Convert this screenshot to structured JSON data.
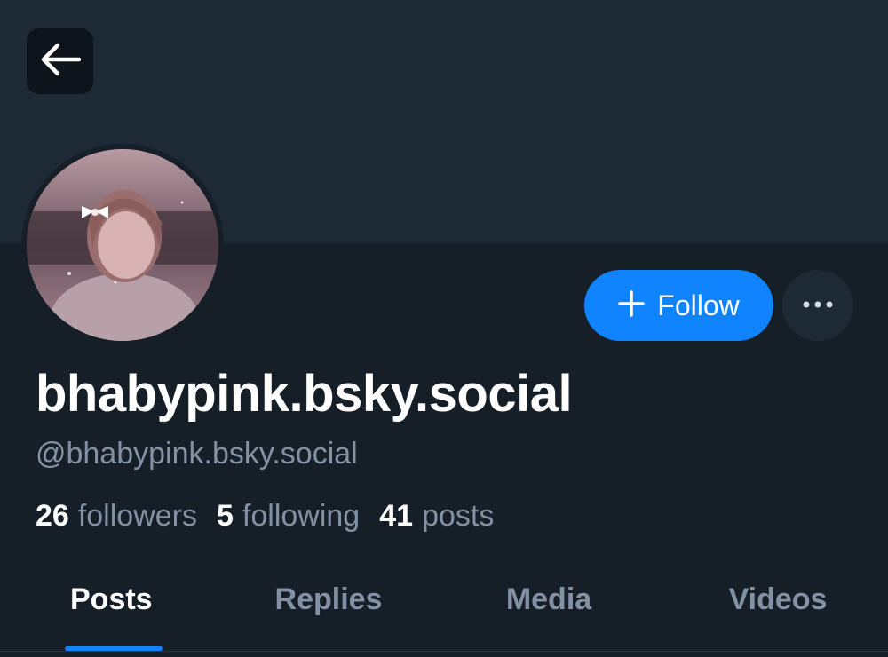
{
  "header": {
    "back_icon": "arrow-left-icon"
  },
  "profile": {
    "display_name": "bhabypink.bsky.social",
    "handle": "@bhabypink.bsky.social",
    "avatar": "profile-avatar-photo"
  },
  "actions": {
    "follow_label": "Follow",
    "follow_icon": "plus-icon",
    "more_icon": "ellipsis-icon"
  },
  "stats": {
    "followers_count": "26",
    "followers_label": "followers",
    "following_count": "5",
    "following_label": "following",
    "posts_count": "41",
    "posts_label": "posts"
  },
  "tabs": [
    {
      "label": "Posts",
      "active": true
    },
    {
      "label": "Replies",
      "active": false
    },
    {
      "label": "Media",
      "active": false
    },
    {
      "label": "Videos",
      "active": false
    }
  ],
  "colors": {
    "background": "#161e27",
    "banner": "#1e2936",
    "accent": "#1083fe",
    "muted_text": "#8292a4"
  }
}
